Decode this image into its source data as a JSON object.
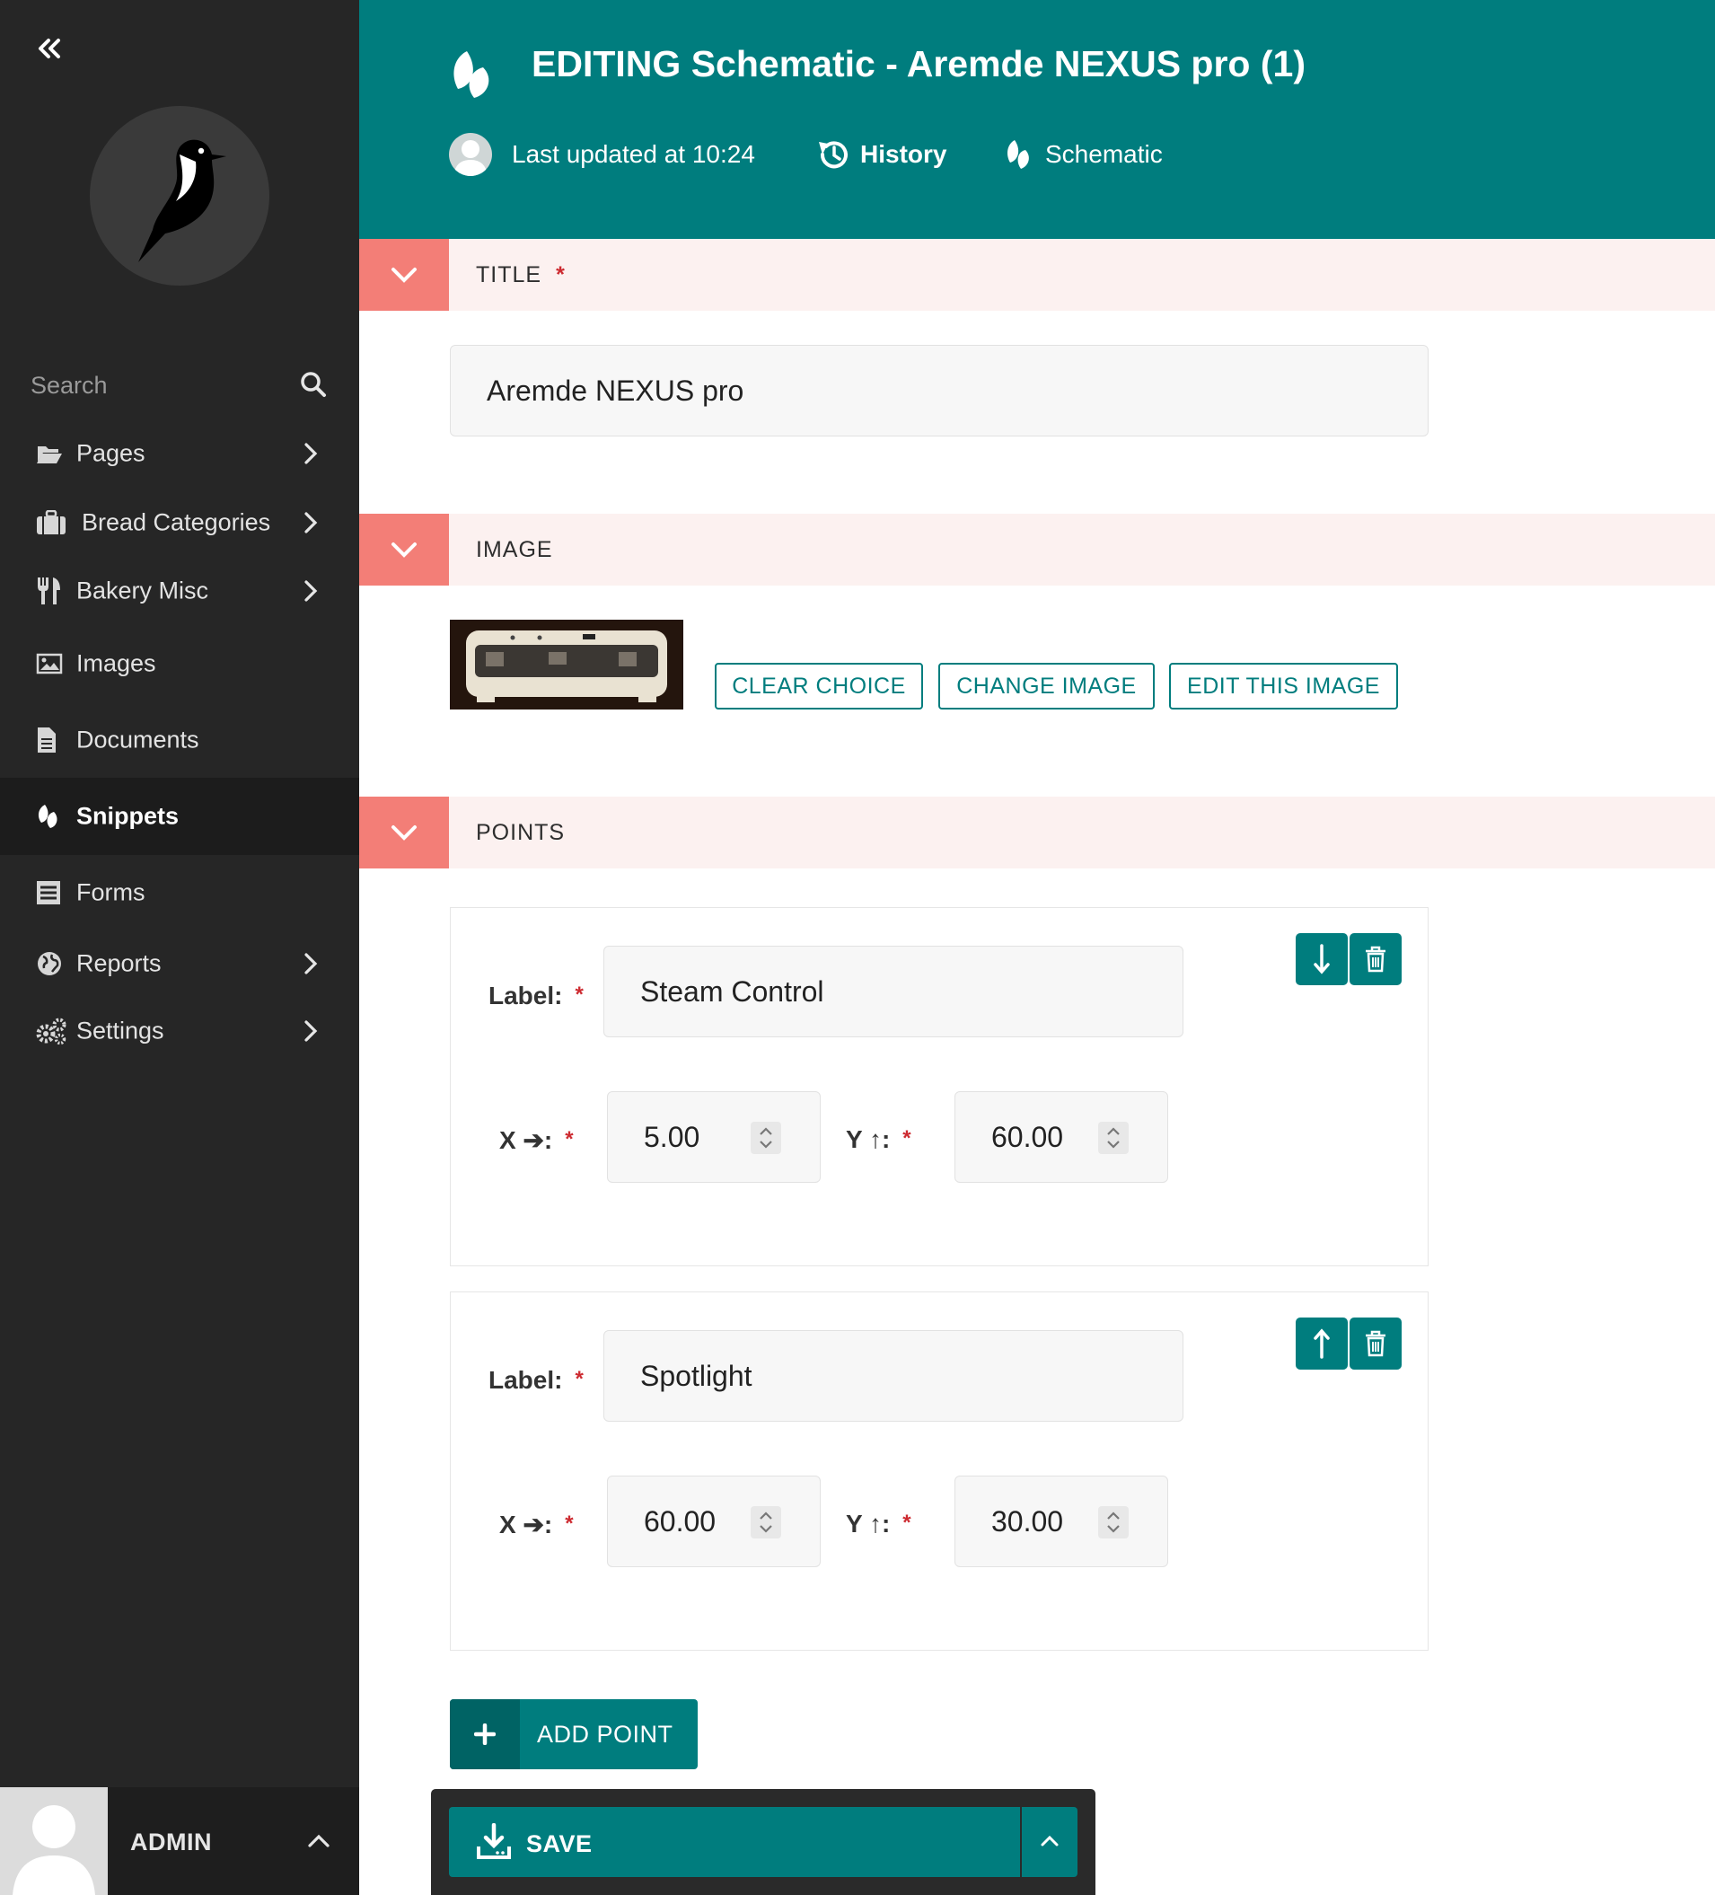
{
  "sidebar": {
    "search": {
      "placeholder": "Search"
    },
    "items": [
      {
        "label": "Pages",
        "icon": "folder-open-icon",
        "has_children": true
      },
      {
        "label": "Bread Categories",
        "icon": "suitcase-icon",
        "has_children": true
      },
      {
        "label": "Bakery Misc",
        "icon": "utensils-icon",
        "has_children": true
      },
      {
        "label": "Images",
        "icon": "image-icon",
        "has_children": false
      },
      {
        "label": "Documents",
        "icon": "document-icon",
        "has_children": false
      },
      {
        "label": "Snippets",
        "icon": "snippet-icon",
        "has_children": false,
        "active": true
      },
      {
        "label": "Forms",
        "icon": "form-icon",
        "has_children": false
      },
      {
        "label": "Reports",
        "icon": "globe-icon",
        "has_children": true
      },
      {
        "label": "Settings",
        "icon": "cogs-icon",
        "has_children": true
      }
    ],
    "account": {
      "name": "ADMIN"
    }
  },
  "header": {
    "title_action": "EDITING",
    "title_rest": "Schematic - Aremde NEXUS pro (1)",
    "last_updated": "Last updated at 10:24",
    "history": "History",
    "type": "Schematic"
  },
  "panels": {
    "title": {
      "label": "TITLE",
      "required": "*",
      "value": "Aremde NEXUS pro"
    },
    "image": {
      "label": "IMAGE",
      "buttons": {
        "clear": "CLEAR CHOICE",
        "change": "CHANGE IMAGE",
        "edit": "EDIT THIS IMAGE"
      }
    },
    "points": {
      "label": "POINTS",
      "label_field": "Label:",
      "x_field": "X ➔:",
      "y_field": "Y ↑:",
      "required": "*",
      "items": [
        {
          "label": "Steam Control",
          "x": "5.00",
          "y": "60.00"
        },
        {
          "label": "Spotlight",
          "x": "60.00",
          "y": "30.00"
        }
      ],
      "add_label": "ADD POINT"
    }
  },
  "footer": {
    "save_label": "SAVE"
  },
  "colors": {
    "primary": "#007d7e",
    "panel_toggle": "#f37e77",
    "panel_bg": "#fcf1f0",
    "sidebar": "#262626",
    "required": "#cd2b31"
  }
}
